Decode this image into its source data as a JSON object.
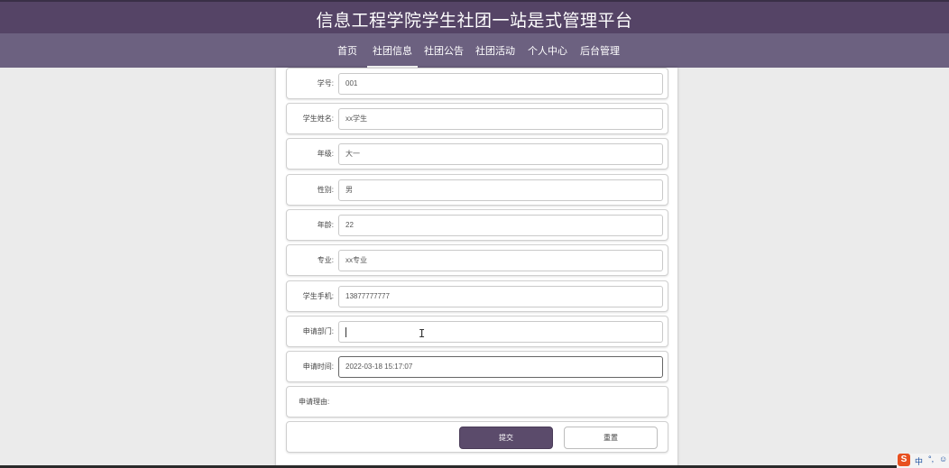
{
  "header": {
    "title": "信息工程学院学生社团一站是式管理平台"
  },
  "nav": {
    "items": [
      {
        "label": "首页"
      },
      {
        "label": "社团信息"
      },
      {
        "label": "社团公告"
      },
      {
        "label": "社团活动"
      },
      {
        "label": "个人中心"
      },
      {
        "label": "后台管理"
      }
    ],
    "active": "社团信息"
  },
  "form": {
    "fields": [
      {
        "label": "学号:",
        "value": "001"
      },
      {
        "label": "学生姓名:",
        "value": "xx学生"
      },
      {
        "label": "年级:",
        "value": "大一"
      },
      {
        "label": "性别:",
        "value": "男"
      },
      {
        "label": "年龄:",
        "value": "22"
      },
      {
        "label": "专业:",
        "value": "xx专业"
      },
      {
        "label": "学生手机:",
        "value": "13877777777"
      },
      {
        "label": "申请部门:",
        "value": ""
      },
      {
        "label": "申请时间:",
        "value": "2022-03-18 15:17:07"
      },
      {
        "label": "申请理由:",
        "value": ""
      }
    ],
    "submit_label": "提交",
    "reset_label": "重置"
  },
  "ime": {
    "logo": "S",
    "lang": "中",
    "punct": "°,",
    "emoji": "☺"
  }
}
